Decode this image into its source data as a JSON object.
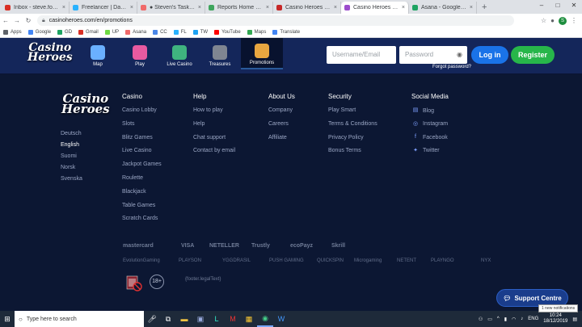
{
  "browser": {
    "tabs": [
      {
        "title": "Inbox - steve.ford.812@...",
        "color": "#d93025",
        "active": false
      },
      {
        "title": "Freelancer | Dashboard",
        "color": "#29b2fe",
        "active": false
      },
      {
        "title": "● Steven's Tasks - Affi...",
        "color": "#f06a6a",
        "active": false
      },
      {
        "title": "Reports Home Page",
        "color": "#3ea55d",
        "active": false
      },
      {
        "title": "Casino Heroes (2019) ...",
        "color": "#c62828",
        "active": false
      },
      {
        "title": "Casino Heroes - Prom...",
        "color": "#9c4dcc",
        "active": true
      },
      {
        "title": "Asana - Google Drive",
        "color": "#1fa463",
        "active": false
      }
    ],
    "new_tab": "+",
    "url": "casinoheroes.com/en/promotions",
    "avatar_letter": "S",
    "bookmarks": [
      {
        "label": "Apps",
        "color": "#5f6368"
      },
      {
        "label": "Google",
        "color": "#4285f4"
      },
      {
        "label": "GD",
        "color": "#1fa463"
      },
      {
        "label": "Gmail",
        "color": "#d93025"
      },
      {
        "label": "UP",
        "color": "#6fda44"
      },
      {
        "label": "Asana",
        "color": "#f06a6a"
      },
      {
        "label": "CC",
        "color": "#4a86e8"
      },
      {
        "label": "FL",
        "color": "#29b2fe"
      },
      {
        "label": "TW",
        "color": "#1da1f2"
      },
      {
        "label": "YouTube",
        "color": "#ff0000"
      },
      {
        "label": "Maps",
        "color": "#34a853"
      },
      {
        "label": "Translate",
        "color": "#4285f4"
      }
    ]
  },
  "site": {
    "logo_line1": "Casino",
    "logo_line2": "Heroes",
    "nav": [
      {
        "label": "Map",
        "icon": "map-icon",
        "color": "#6ab0ff",
        "active": false
      },
      {
        "label": "Play",
        "icon": "play-icon",
        "color": "#e85aa0",
        "active": false
      },
      {
        "label": "Live Casino",
        "icon": "live-casino-icon",
        "color": "#3fb37f",
        "active": false
      },
      {
        "label": "Treasures",
        "icon": "treasure-chest-icon",
        "color": "#7f8591",
        "active": false
      },
      {
        "label": "Promotions",
        "icon": "promotions-icon",
        "color": "#e8a640",
        "active": true
      }
    ],
    "username_placeholder": "Username/Email",
    "password_placeholder": "Password",
    "login_label": "Log in",
    "register_label": "Register",
    "forgot_label": "Forgot password?",
    "login_color": "#1a73e8",
    "register_color": "#27b64a"
  },
  "footer": {
    "languages": [
      "Deutsch",
      "English",
      "Suomi",
      "Norsk",
      "Svenska"
    ],
    "current_language": "English",
    "columns": [
      {
        "heading": "Casino",
        "links": [
          "Casino Lobby",
          "Slots",
          "Blitz Games",
          "Live Casino",
          "Jackpot Games",
          "Roulette",
          "Blackjack",
          "Table Games",
          "Scratch Cards"
        ]
      },
      {
        "heading": "Help",
        "links": [
          "How to play",
          "Help",
          "Chat support",
          "Contact by email"
        ]
      },
      {
        "heading": "About Us",
        "links": [
          "Company",
          "Careers",
          "Affiliate"
        ]
      },
      {
        "heading": "Security",
        "links": [
          "Play Smart",
          "Terms & Conditions",
          "Privacy Policy",
          "Bonus Terms"
        ]
      }
    ],
    "social_heading": "Social Media",
    "social": [
      {
        "label": "Blog",
        "icon": "blog-icon",
        "glyph": "▤"
      },
      {
        "label": "Instagram",
        "icon": "instagram-icon",
        "glyph": "◎"
      },
      {
        "label": "Facebook",
        "icon": "facebook-icon",
        "glyph": "f"
      },
      {
        "label": "Twitter",
        "icon": "twitter-icon",
        "glyph": "✦"
      }
    ],
    "payments": [
      "mastercard",
      "VISA",
      "NETELLER",
      "Trustly",
      "ecoPayz",
      "Skrill"
    ],
    "providers": [
      "EvolutionGaming",
      "PLAYSON",
      "YGGDRASIL",
      "PUSH GAMING",
      "QUICKSPIN",
      "Microgaming",
      "NETENT",
      "PLAYNGO",
      "NYX"
    ],
    "age_badge": "18+",
    "legal_text": "{footer.legalText}",
    "support_label": "Support Centre"
  },
  "taskbar": {
    "search_placeholder": "Type here to search",
    "language": "ENG",
    "time": "10:24",
    "date": "18/12/2019",
    "notification": "1 new notifications"
  }
}
